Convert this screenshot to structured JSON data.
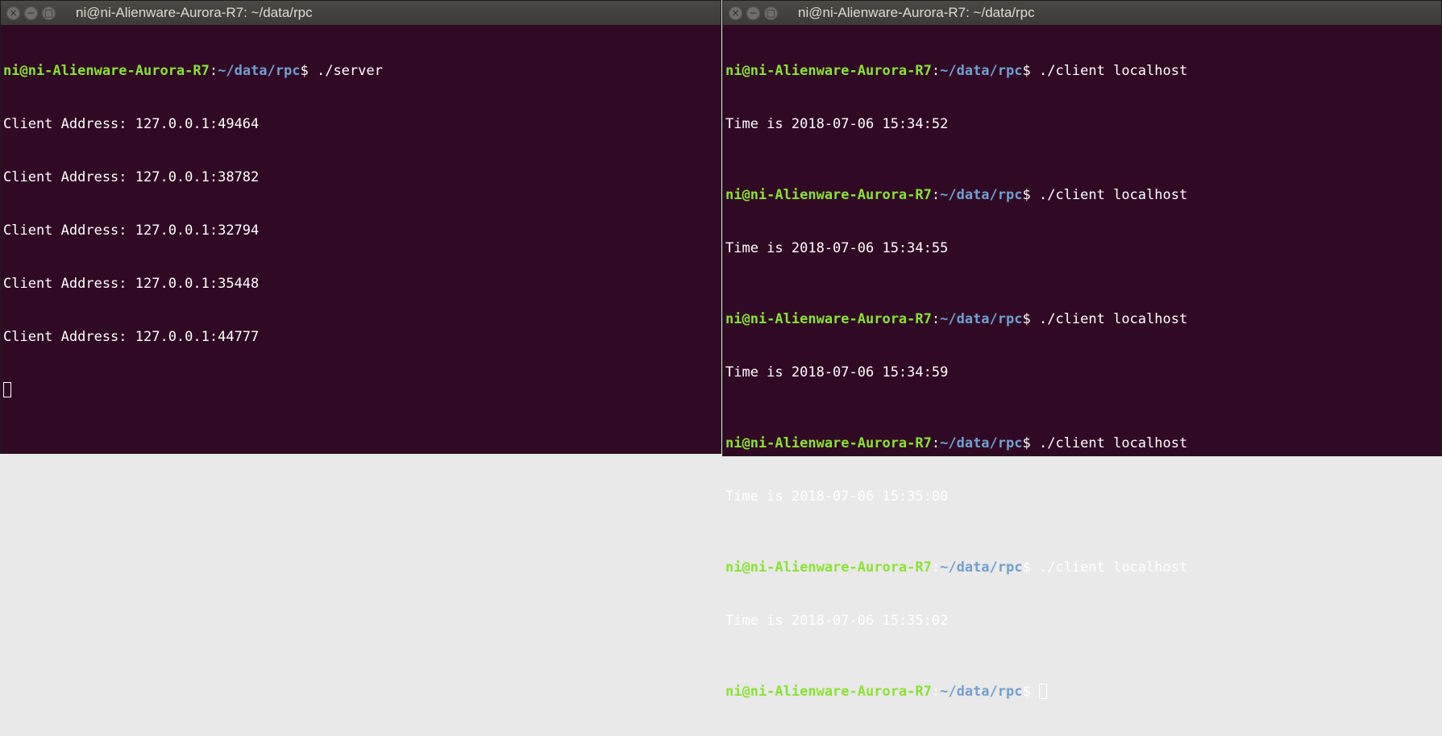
{
  "left": {
    "title": "ni@ni-Alienware-Aurora-R7: ~/data/rpc",
    "prompt": {
      "user": "ni@ni-Alienware-Aurora-R7",
      "colon": ":",
      "path": "~/data/rpc",
      "symbol": "$"
    },
    "command": " ./server",
    "output": [
      "Client Address: 127.0.0.1:49464",
      "Client Address: 127.0.0.1:38782",
      "Client Address: 127.0.0.1:32794",
      "Client Address: 127.0.0.1:35448",
      "Client Address: 127.0.0.1:44777"
    ]
  },
  "right": {
    "title": "ni@ni-Alienware-Aurora-R7: ~/data/rpc",
    "prompt": {
      "user": "ni@ni-Alienware-Aurora-R7",
      "colon": ":",
      "path": "~/data/rpc",
      "symbol": "$"
    },
    "sessions": [
      {
        "command": " ./client localhost",
        "output": "Time is 2018-07-06 15:34:52"
      },
      {
        "command": " ./client localhost",
        "output": "Time is 2018-07-06 15:34:55"
      },
      {
        "command": " ./client localhost",
        "output": "Time is 2018-07-06 15:34:59"
      },
      {
        "command": " ./client localhost",
        "output": "Time is 2018-07-06 15:35:00"
      },
      {
        "command": " ./client localhost",
        "output": "Time is 2018-07-06 15:35:02"
      }
    ],
    "final_command": " "
  },
  "window_buttons": {
    "close": "×",
    "minimize": "−",
    "maximize": "□"
  },
  "colors": {
    "terminal_bg": "#300a24",
    "user": "#8ae234",
    "path": "#729fcf",
    "text": "#ffffff",
    "titlebar": "#3c3b37"
  }
}
